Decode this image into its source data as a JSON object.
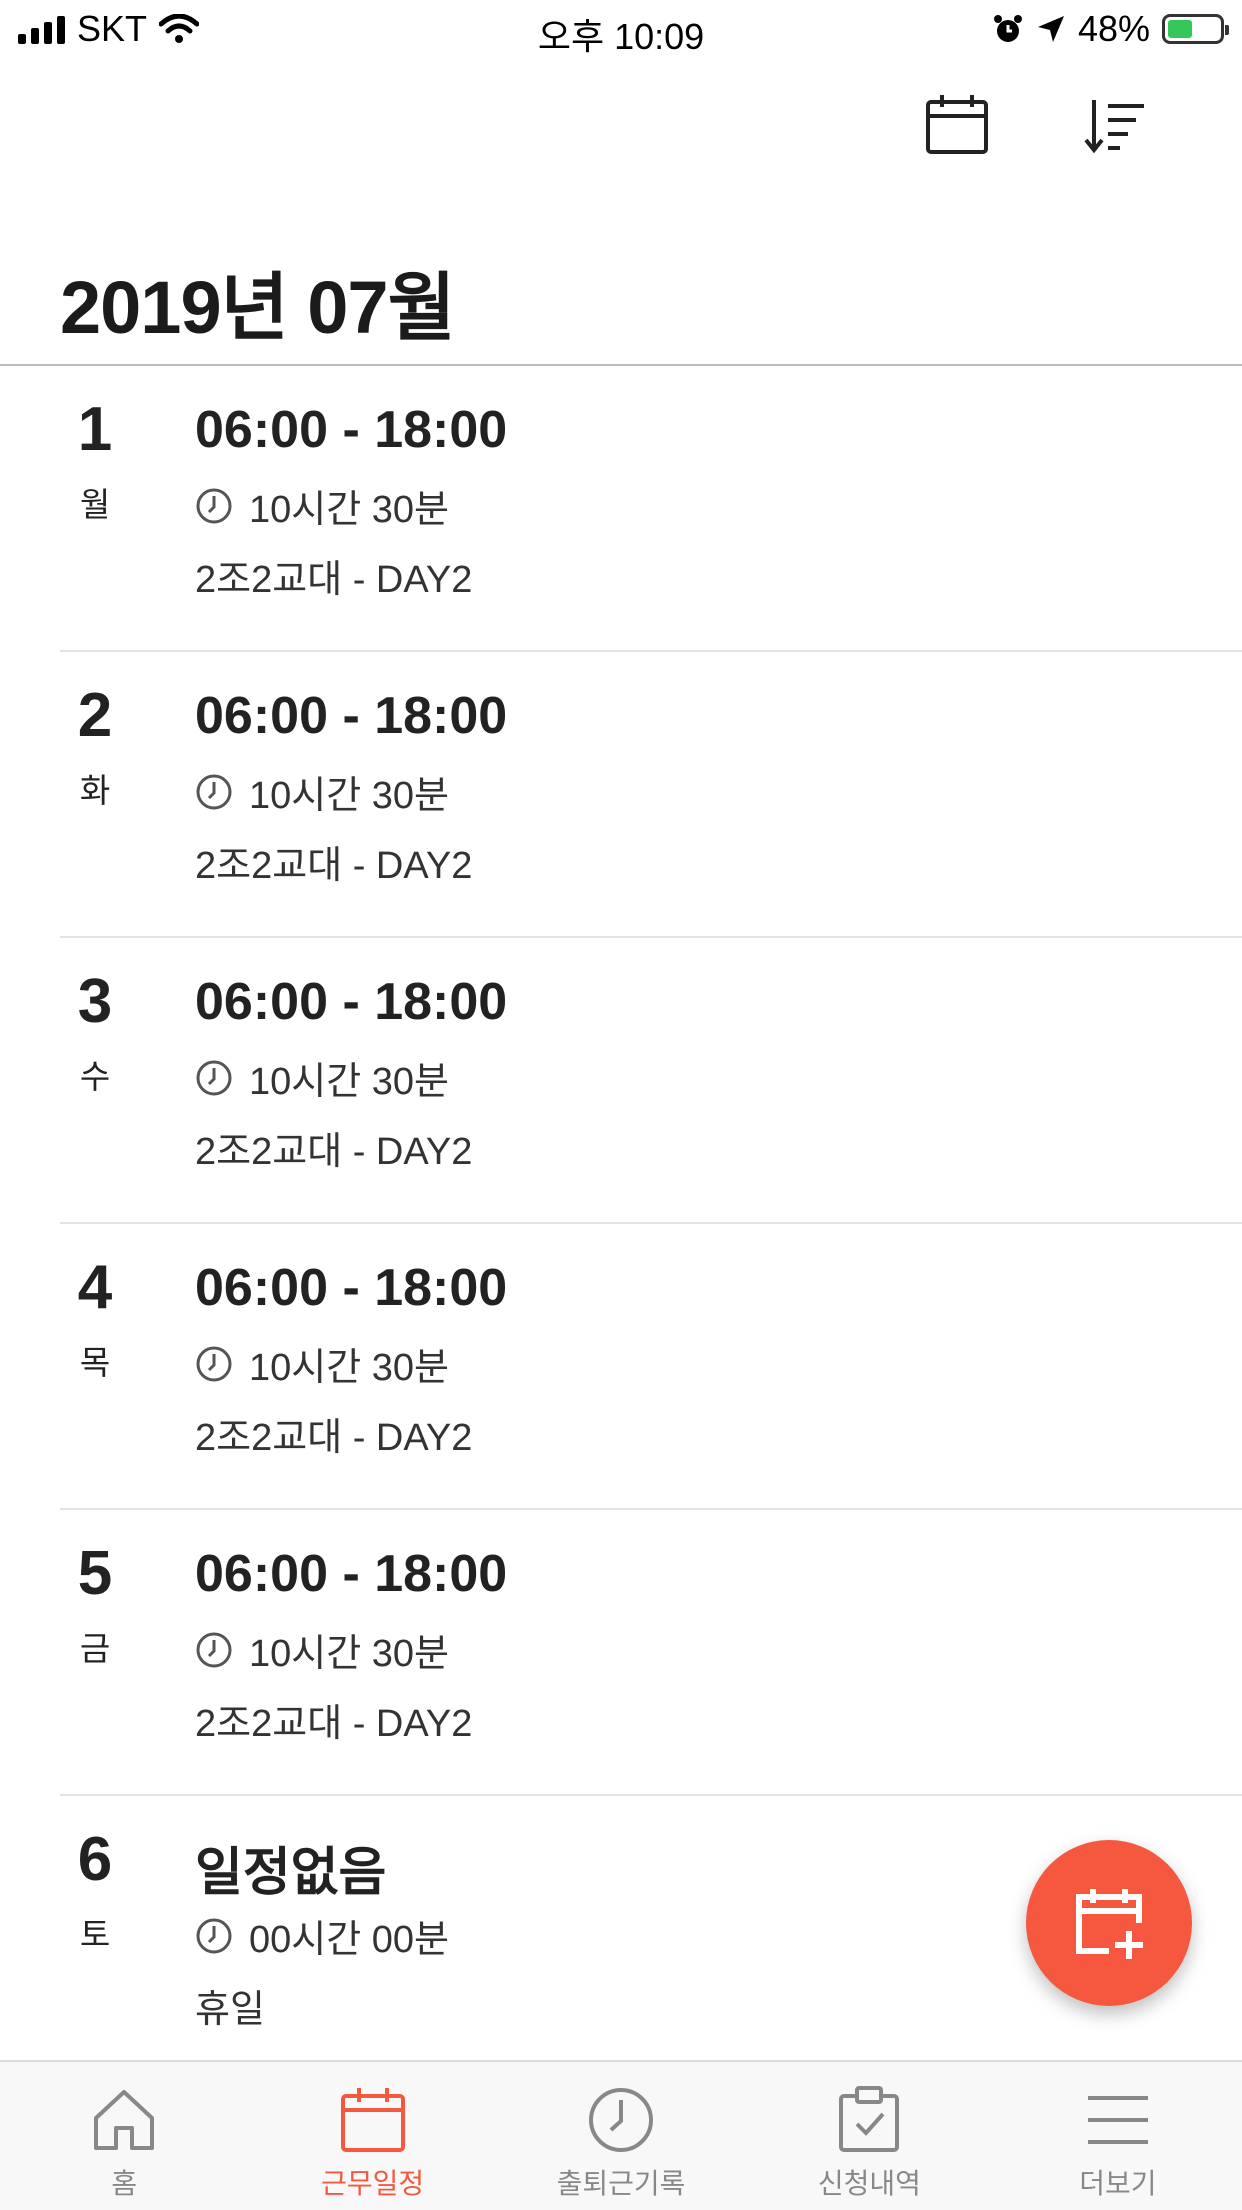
{
  "status_bar": {
    "carrier": "SKT",
    "time": "오후 10:09",
    "battery": "48%",
    "battery_level": 0.48
  },
  "header": {
    "calendar_icon": "calendar-icon",
    "sort_icon": "sort-icon",
    "month_title": "2019년 07월"
  },
  "schedule": [
    {
      "day": "1",
      "weekday": "월",
      "time": "06:00 - 18:00",
      "duration": "10시간 30분",
      "shift": "2조2교대 - DAY2"
    },
    {
      "day": "2",
      "weekday": "화",
      "time": "06:00 - 18:00",
      "duration": "10시간 30분",
      "shift": "2조2교대 - DAY2"
    },
    {
      "day": "3",
      "weekday": "수",
      "time": "06:00 - 18:00",
      "duration": "10시간 30분",
      "shift": "2조2교대 - DAY2"
    },
    {
      "day": "4",
      "weekday": "목",
      "time": "06:00 - 18:00",
      "duration": "10시간 30분",
      "shift": "2조2교대 - DAY2"
    },
    {
      "day": "5",
      "weekday": "금",
      "time": "06:00 - 18:00",
      "duration": "10시간 30분",
      "shift": "2조2교대 - DAY2"
    },
    {
      "day": "6",
      "weekday": "토",
      "time": "일정없음",
      "duration": "00시간 00분",
      "shift": "휴일"
    }
  ],
  "fab": {
    "icon": "calendar-plus-icon",
    "color": "#f5583e"
  },
  "tabs": [
    {
      "label": "홈",
      "icon": "home-icon",
      "active": false
    },
    {
      "label": "근무일정",
      "icon": "calendar-icon",
      "active": true
    },
    {
      "label": "출퇴근기록",
      "icon": "clock-icon",
      "active": false
    },
    {
      "label": "신청내역",
      "icon": "checklist-icon",
      "active": false
    },
    {
      "label": "더보기",
      "icon": "menu-icon",
      "active": false
    }
  ],
  "colors": {
    "accent": "#f5583e",
    "text": "#222222",
    "inactive": "#888888"
  }
}
